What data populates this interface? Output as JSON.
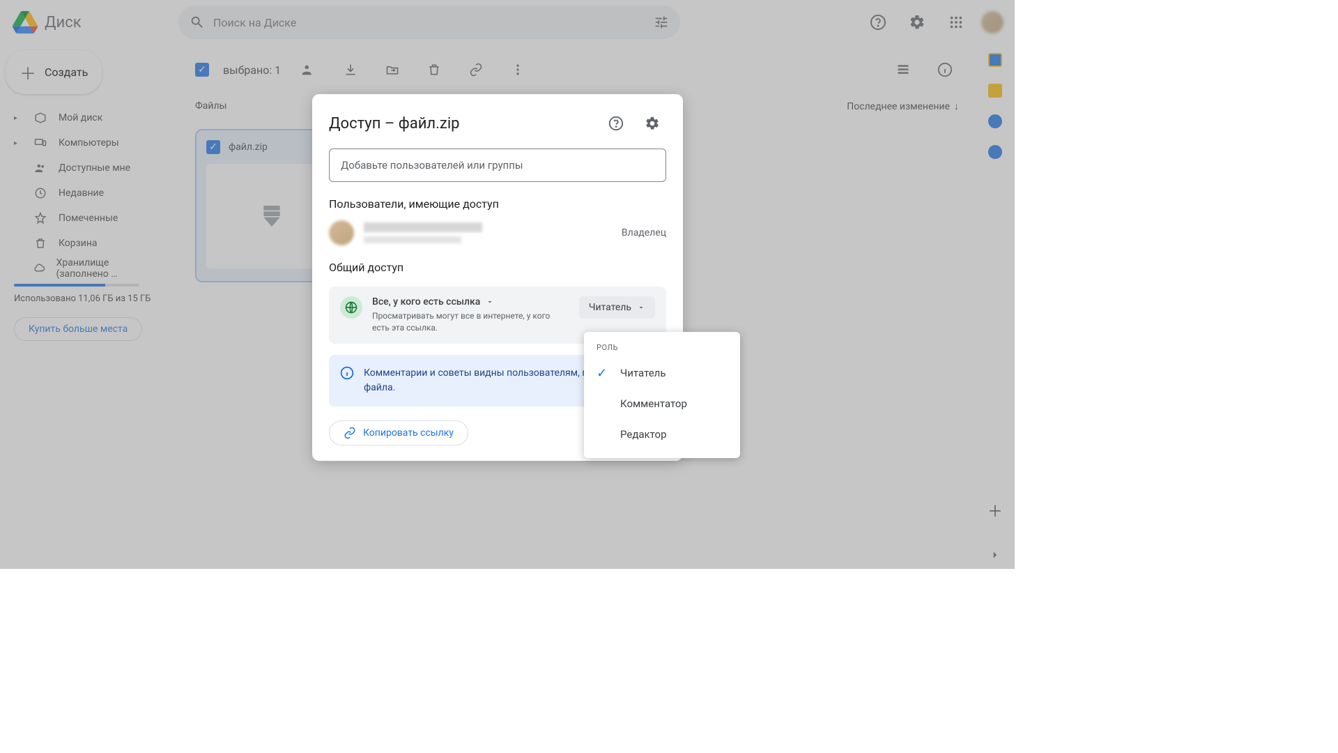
{
  "app_name": "Диск",
  "search": {
    "placeholder": "Поиск на Диске"
  },
  "create_label": "Создать",
  "nav": [
    {
      "label": "Мой диск",
      "icon": "drive",
      "chev": true
    },
    {
      "label": "Компьютеры",
      "icon": "devices",
      "chev": true
    },
    {
      "label": "Доступные мне",
      "icon": "people",
      "chev": false
    },
    {
      "label": "Недавние",
      "icon": "clock",
      "chev": false
    },
    {
      "label": "Помеченные",
      "icon": "star",
      "chev": false
    },
    {
      "label": "Корзина",
      "icon": "trash",
      "chev": false
    },
    {
      "label": "Хранилище (заполнено …",
      "icon": "cloud",
      "chev": false
    }
  ],
  "storage": {
    "percent": 73,
    "text": "Использовано 11,06 ГБ из 15 ГБ",
    "buy": "Купить больше места"
  },
  "toolbar": {
    "selected": "выбрано: 1"
  },
  "files": {
    "header": "Файлы",
    "sort": "Последнее изменение",
    "item": {
      "name": "файл.zip"
    }
  },
  "modal": {
    "title": "Доступ – файл.zip",
    "add_placeholder": "Добавьте пользователей или группы",
    "users_header": "Пользователи, имеющие доступ",
    "owner": "Владелец",
    "general_header": "Общий доступ",
    "link_title": "Все, у кого есть ссылка",
    "link_desc": "Просматривать могут все в интернете, у кого есть эта ссылка.",
    "role_selected": "Читатель",
    "info": "Комментарии и советы видны пользователям, просмотр файла.",
    "copy_link": "Копировать ссылку"
  },
  "role_menu": {
    "header": "РОЛЬ",
    "items": [
      "Читатель",
      "Комментатор",
      "Редактор"
    ],
    "selected_index": 0
  }
}
